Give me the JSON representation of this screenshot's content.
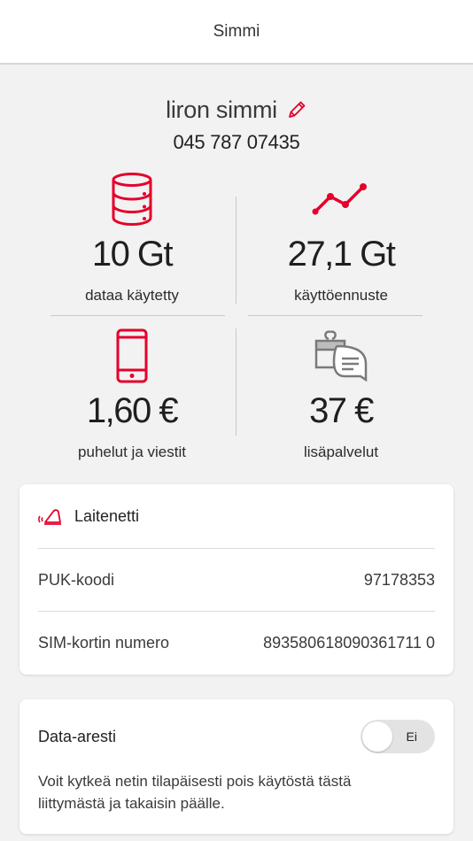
{
  "topbar": {
    "title": "Simmi"
  },
  "profile": {
    "name": "liron simmi",
    "edit_icon": "pencil-icon",
    "phone": "045 787 07435"
  },
  "stats": [
    {
      "icon": "database-icon",
      "value": "10 Gt",
      "label": "dataa käytetty"
    },
    {
      "icon": "trend-line-icon",
      "value": "27,1 Gt",
      "label": "käyttöennuste"
    },
    {
      "icon": "mobile-phone-icon",
      "value": "1,60 €",
      "label": "puhelut ja viestit"
    },
    {
      "icon": "gift-chat-icon",
      "value": "37 €",
      "label": "lisäpalvelut"
    }
  ],
  "device_card": {
    "icon": "router-icon",
    "title": "Laitenetti",
    "rows": [
      {
        "label": "PUK-koodi",
        "value": "97178353"
      },
      {
        "label": "SIM-kortin numero",
        "value": "893580618090361711 0"
      }
    ]
  },
  "data_arrest": {
    "title": "Data-aresti",
    "toggle_text": "Ei",
    "description": "Voit kytkeä netin tilapäisesti pois käytöstä tästä liittymästä ja takaisin päälle."
  },
  "colors": {
    "accent": "#e4002b",
    "icon_gray": "#7a7a7a"
  }
}
